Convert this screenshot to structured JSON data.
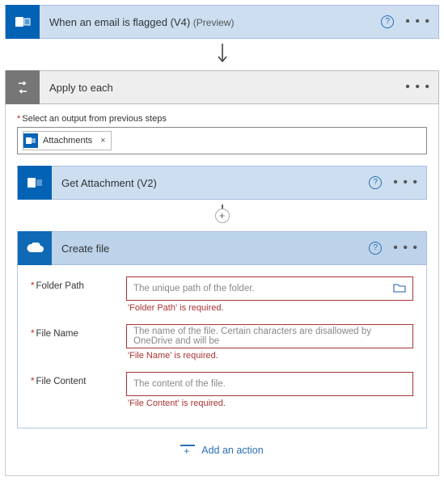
{
  "trigger": {
    "title": "When an email is flagged (V4)",
    "badge": "(Preview)"
  },
  "foreach": {
    "title": "Apply to each",
    "outputLabel": "Select an output from previous steps",
    "tokenLabel": "Attachments",
    "tokenClose": "×"
  },
  "getAttachment": {
    "title": "Get Attachment (V2)"
  },
  "createFile": {
    "title": "Create file",
    "fields": {
      "folderPath": {
        "label": "Folder Path",
        "placeholder": "The unique path of the folder.",
        "error": "'Folder Path' is required."
      },
      "fileName": {
        "label": "File Name",
        "placeholder": "The name of the file. Certain characters are disallowed by OneDrive and will be",
        "error": "'File Name' is required."
      },
      "fileContent": {
        "label": "File Content",
        "placeholder": "The content of the file.",
        "error": "'File Content' is required."
      }
    }
  },
  "addAction": "Add an action",
  "glyphs": {
    "plus": "+",
    "dots": "• • •",
    "help": "?"
  }
}
